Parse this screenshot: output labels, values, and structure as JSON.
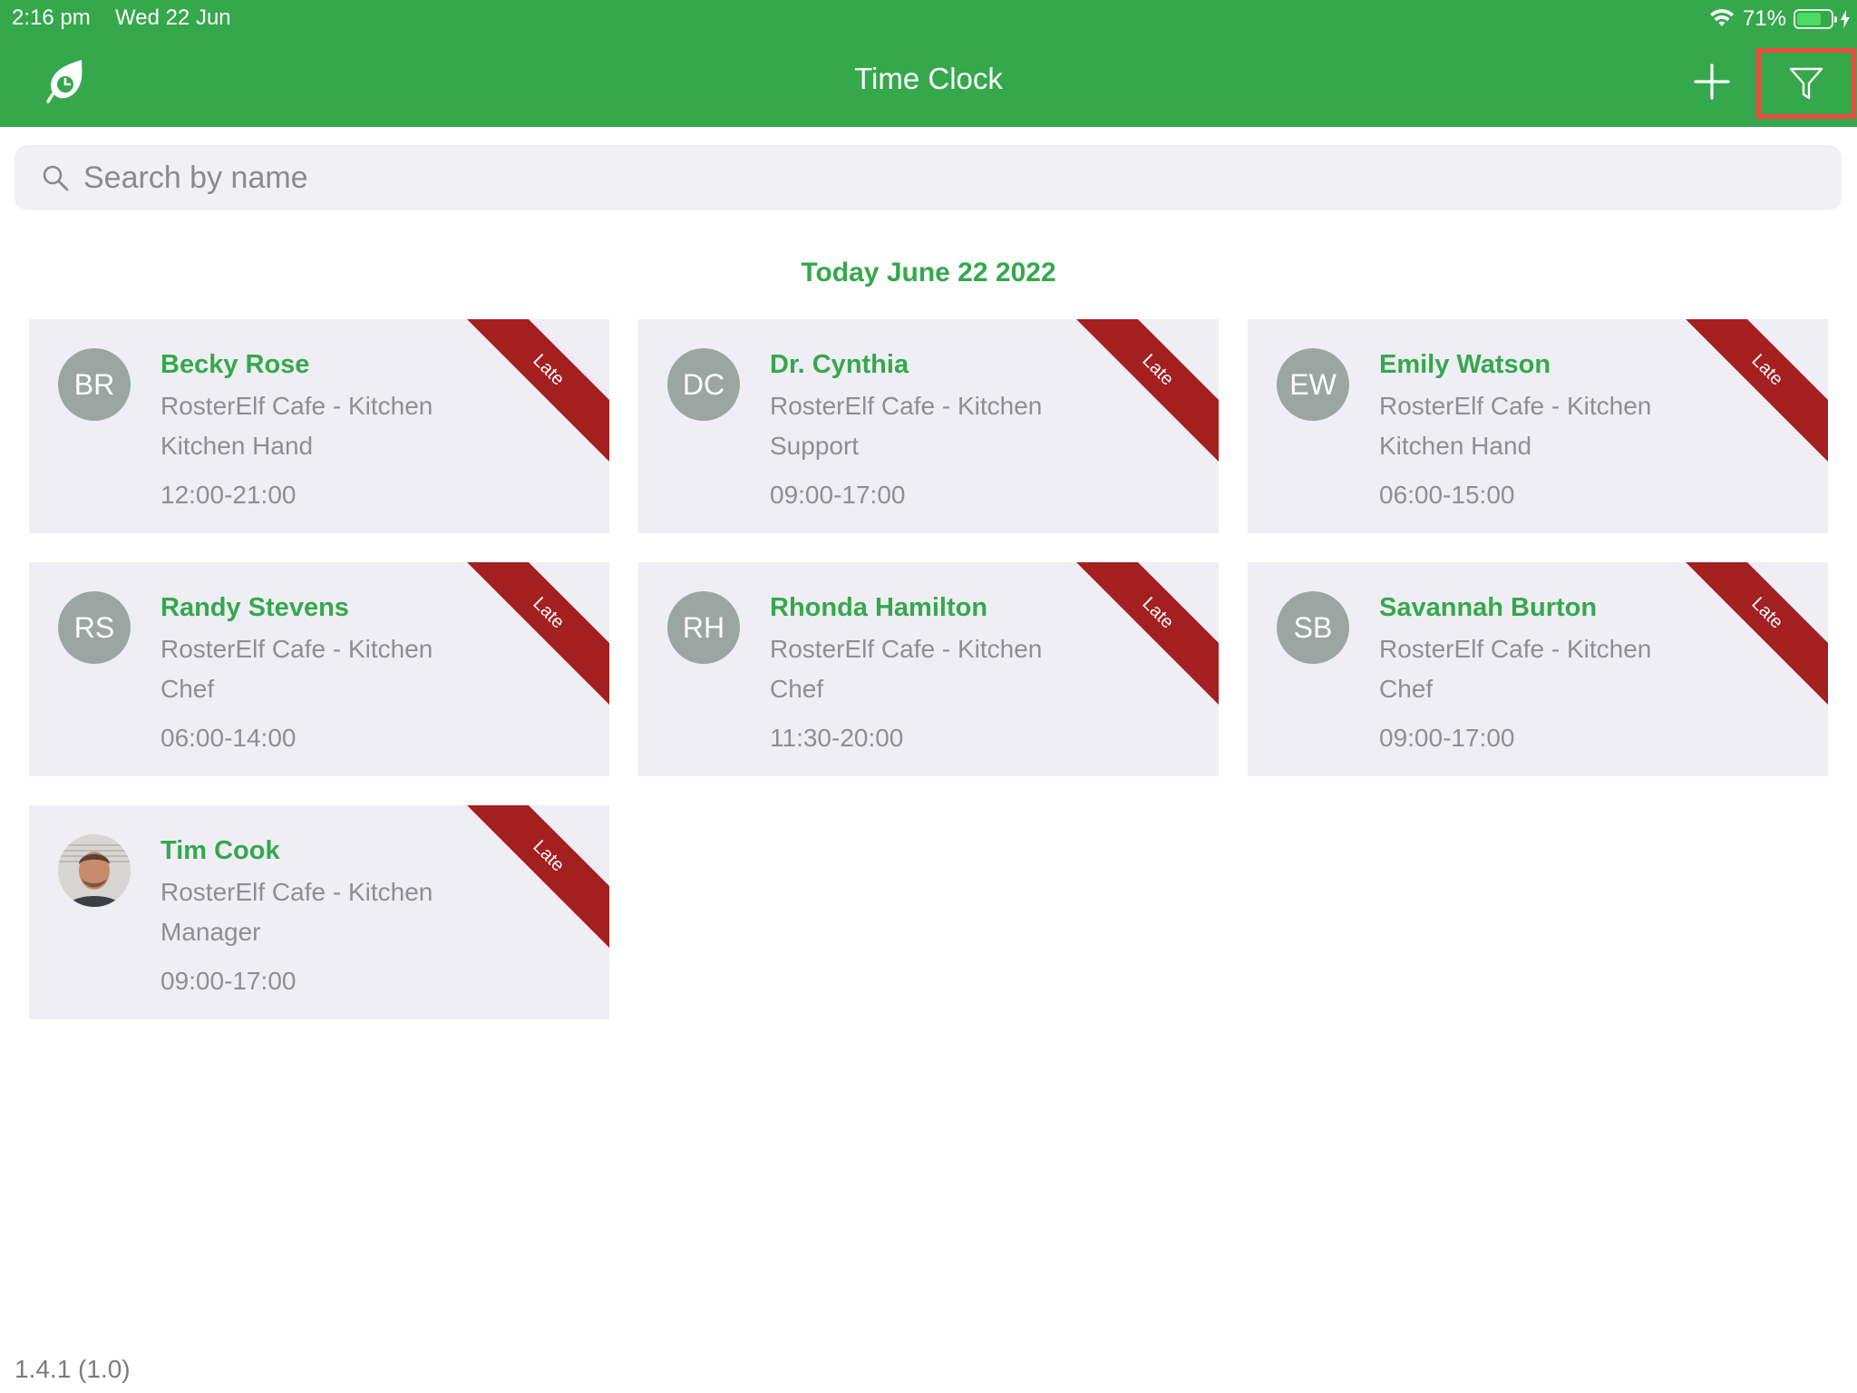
{
  "status_bar": {
    "time": "2:16 pm",
    "date": "Wed 22 Jun",
    "battery": "71%"
  },
  "header": {
    "title": "Time Clock"
  },
  "search": {
    "placeholder": "Search by name"
  },
  "date_heading": "Today June 22 2022",
  "cards": [
    {
      "initials": "BR",
      "name": "Becky Rose",
      "location": "RosterElf Cafe - Kitchen",
      "role": "Kitchen Hand",
      "hours": "12:00-21:00",
      "status": "Late"
    },
    {
      "initials": "DC",
      "name": "Dr. Cynthia",
      "location": "RosterElf Cafe - Kitchen",
      "role": "Support",
      "hours": "09:00-17:00",
      "status": "Late"
    },
    {
      "initials": "EW",
      "name": "Emily Watson",
      "location": "RosterElf Cafe - Kitchen",
      "role": "Kitchen Hand",
      "hours": "06:00-15:00",
      "status": "Late"
    },
    {
      "initials": "RS",
      "name": "Randy Stevens",
      "location": "RosterElf Cafe - Kitchen",
      "role": "Chef",
      "hours": "06:00-14:00",
      "status": "Late"
    },
    {
      "initials": "RH",
      "name": "Rhonda Hamilton",
      "location": "RosterElf Cafe - Kitchen",
      "role": "Chef",
      "hours": "11:30-20:00",
      "status": "Late"
    },
    {
      "initials": "SB",
      "name": "Savannah Burton",
      "location": "RosterElf Cafe - Kitchen",
      "role": "Chef",
      "hours": "09:00-17:00",
      "status": "Late"
    },
    {
      "initials": "",
      "name": "Tim Cook",
      "location": "RosterElf Cafe - Kitchen",
      "role": "Manager",
      "hours": "09:00-17:00",
      "status": "Late"
    }
  ],
  "version": "1.4.1 (1.0)",
  "colors": {
    "brand_green": "#35a84c",
    "late_ribbon": "#a41f20",
    "card_bg": "#efeef4",
    "highlight": "#ef4a3e"
  }
}
